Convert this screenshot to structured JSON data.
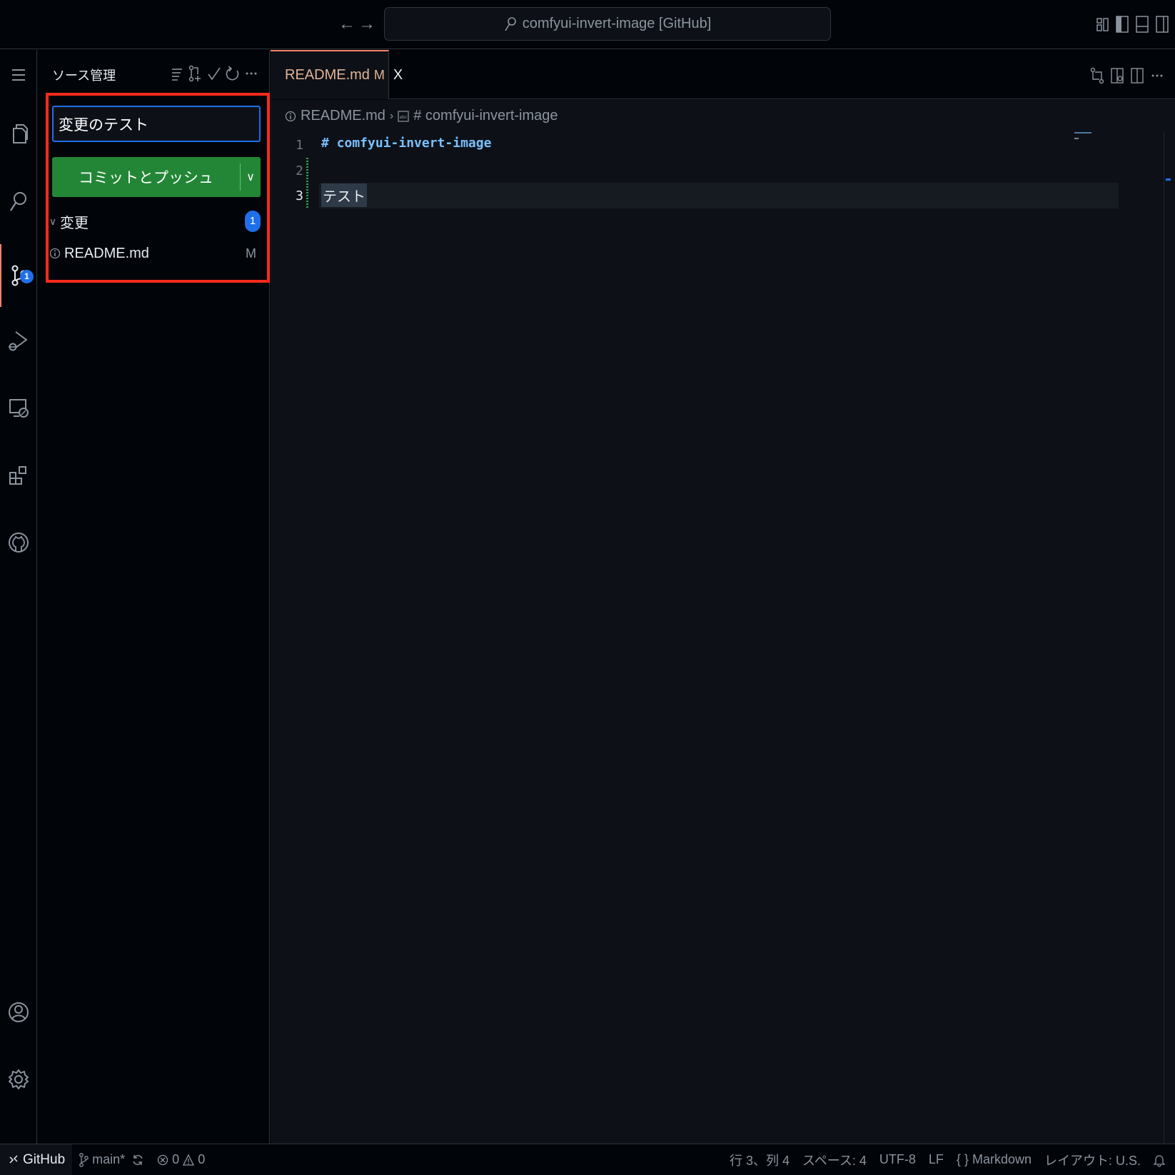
{
  "titlebar": {
    "search_text": "comfyui-invert-image [GitHub]",
    "back_icon": "arrow-left-icon",
    "forward_icon": "arrow-right-icon"
  },
  "activity_bar": {
    "items": [
      {
        "name": "menu",
        "icon": "hamburger-menu-icon"
      },
      {
        "name": "explorer",
        "icon": "files-icon"
      },
      {
        "name": "search",
        "icon": "search-icon"
      },
      {
        "name": "source-control",
        "icon": "source-control-icon",
        "badge": "1",
        "active": true
      },
      {
        "name": "run-debug",
        "icon": "run-debug-icon"
      },
      {
        "name": "remote-explorer",
        "icon": "remote-explorer-icon"
      },
      {
        "name": "extensions",
        "icon": "extensions-icon"
      },
      {
        "name": "github",
        "icon": "github-icon"
      },
      {
        "name": "accounts",
        "icon": "account-icon"
      },
      {
        "name": "manage",
        "icon": "gear-icon"
      }
    ]
  },
  "sidebar": {
    "title": "ソース管理",
    "commit_message": "変更のテスト",
    "commit_button": "コミットとプッシュ",
    "changes_label": "変更",
    "changes_count": "1",
    "files": [
      {
        "name": "README.md",
        "status": "M"
      }
    ]
  },
  "editor": {
    "tab": {
      "name": "README.md",
      "modified": "M",
      "close": "X"
    },
    "breadcrumb": {
      "file": "README.md",
      "symbol": "# comfyui-invert-image"
    },
    "lines": [
      {
        "number": "1",
        "text": "# comfyui-invert-image"
      },
      {
        "number": "2",
        "text": ""
      },
      {
        "number": "3",
        "text": "テスト"
      }
    ]
  },
  "statusbar": {
    "remote": "GitHub",
    "branch": "main*",
    "errors": "0",
    "warnings": "0",
    "cursor": "行 3、列 4",
    "indent": "スペース: 4",
    "encoding": "UTF-8",
    "eol": "LF",
    "language": "Markdown",
    "keyboard": "レイアウト: U.S."
  },
  "colors": {
    "accent": "#1f6feb",
    "commit_button": "#238636",
    "active_tab_border": "#f78166",
    "highlight_box": "#ff2a1a",
    "modified_file": "#e3b395"
  }
}
